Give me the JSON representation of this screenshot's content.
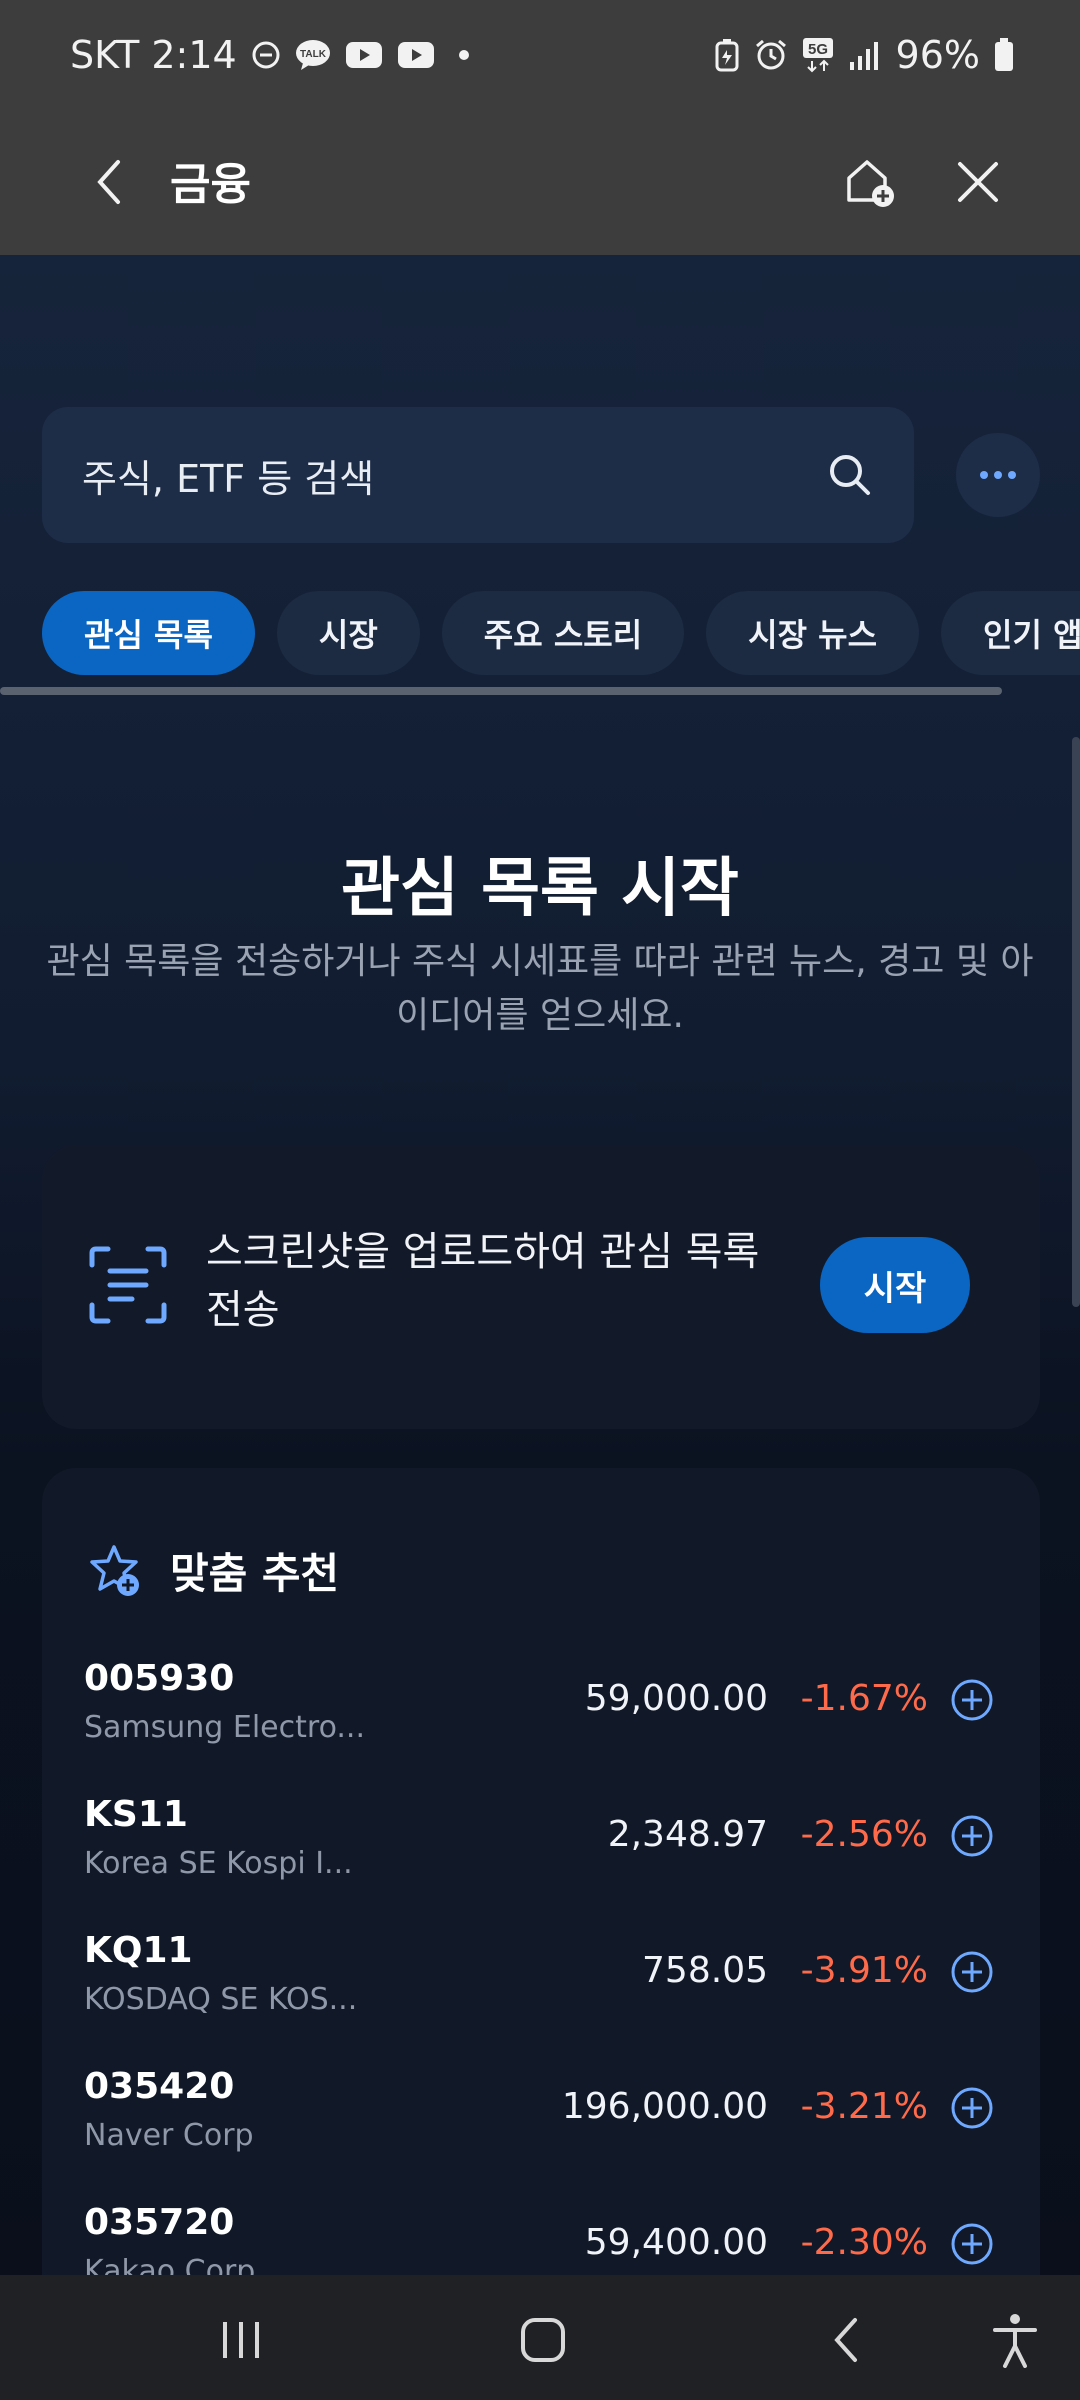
{
  "status_bar": {
    "carrier_time": "SKT 2:14",
    "battery": "96%",
    "network": "5G",
    "icons": [
      "dnd-icon",
      "kakaotalk-icon",
      "youtube-icon",
      "youtube-icon",
      "dot-icon",
      "battery-saver-icon",
      "alarm-icon",
      "5g-icon",
      "signal-icon",
      "battery-icon"
    ]
  },
  "app_bar": {
    "title": "금융"
  },
  "search": {
    "placeholder": "주식, ETF 등 검색"
  },
  "tabs": [
    {
      "label": "관심 목록",
      "active": true
    },
    {
      "label": "시장",
      "active": false
    },
    {
      "label": "주요 스토리",
      "active": false
    },
    {
      "label": "시장 뉴스",
      "active": false
    },
    {
      "label": "인기 앱",
      "active": false
    }
  ],
  "hero": {
    "title": "관심 목록 시작",
    "description": "관심 목록을 전송하거나 주식 시세표를 따라 관련 뉴스, 경고 및 아이디어를 얻으세요."
  },
  "upload_card": {
    "text": "스크린샷을 업로드하여 관심 목록 전송",
    "button_label": "시작"
  },
  "recommendations": {
    "title": "맞춤 추천",
    "items": [
      {
        "symbol": "005930",
        "name": "Samsung Electro...",
        "price": "59,000.00",
        "change": "-1.67%"
      },
      {
        "symbol": "KS11",
        "name": "Korea SE Kospi I...",
        "price": "2,348.97",
        "change": "-2.56%"
      },
      {
        "symbol": "KQ11",
        "name": "KOSDAQ SE KOS...",
        "price": "758.05",
        "change": "-3.91%"
      },
      {
        "symbol": "035420",
        "name": "Naver Corp",
        "price": "196,000.00",
        "change": "-3.21%"
      },
      {
        "symbol": "035720",
        "name": "Kakao Corp",
        "price": "59,400.00",
        "change": "-2.30%"
      }
    ]
  },
  "colors": {
    "accent": "#0a66c2",
    "negative": "#ff6b4a",
    "icon_blue": "#6fa8ff"
  }
}
